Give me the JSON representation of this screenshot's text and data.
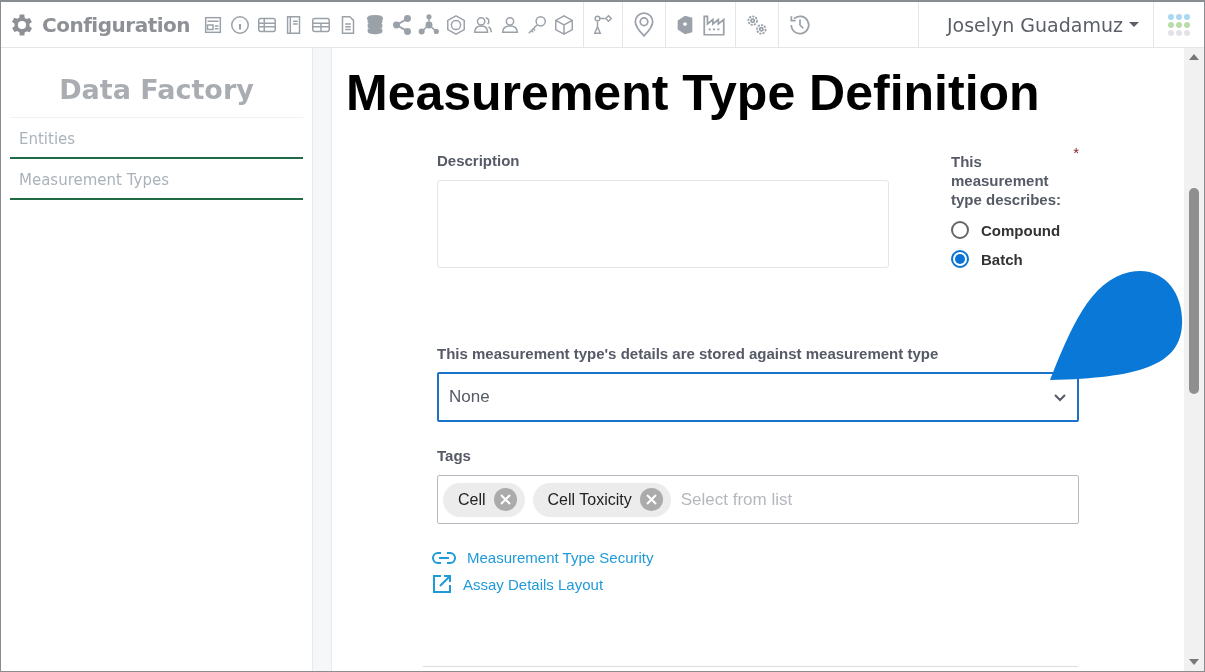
{
  "header": {
    "title": "Configuration",
    "user": "Joselyn Guadamuz"
  },
  "sidebar": {
    "title": "Data Factory",
    "items": [
      {
        "label": "Entities"
      },
      {
        "label": "Measurement Types"
      }
    ]
  },
  "page": {
    "title": "Measurement Type Definition"
  },
  "form": {
    "description": {
      "label": "Description"
    },
    "describes": {
      "label": "This measurement type describes:",
      "required_mark": "*",
      "options": [
        {
          "label": "Compound",
          "selected": false
        },
        {
          "label": "Batch",
          "selected": true
        }
      ]
    },
    "stored_against": {
      "label": "This measurement type's details are stored against measurement type",
      "value": "None"
    },
    "tags": {
      "label": "Tags",
      "items": [
        "Cell",
        "Cell Toxicity"
      ],
      "placeholder": "Select from list"
    },
    "links": [
      {
        "kind": "link",
        "label": "Measurement Type Security"
      },
      {
        "kind": "external",
        "label": "Assay Details Layout"
      }
    ]
  }
}
